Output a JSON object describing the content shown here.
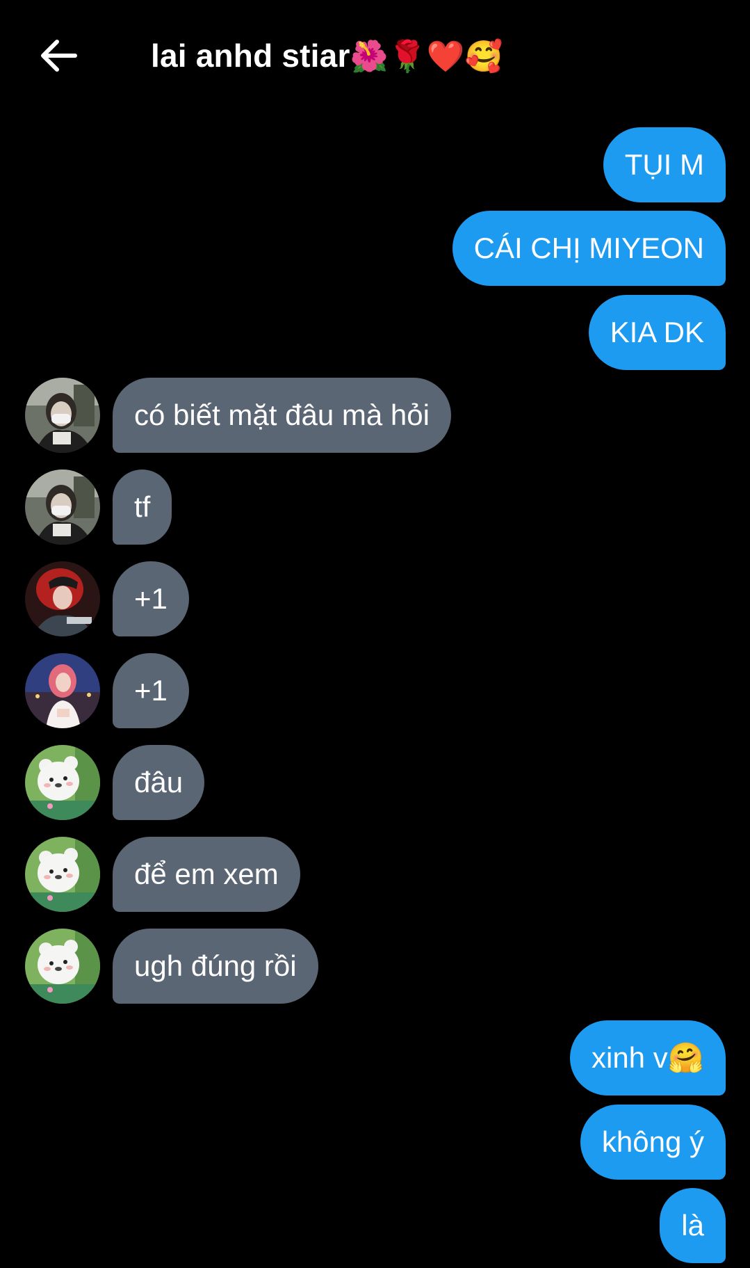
{
  "header": {
    "back_icon": "arrow-left-icon",
    "title": "lai anhd stiar",
    "title_emojis": "🌺🌹❤️🥰"
  },
  "colors": {
    "background": "#000000",
    "outgoing_bubble": "#1d9bf0",
    "incoming_bubble": "#5b6674",
    "text": "#ffffff"
  },
  "messages": [
    {
      "direction": "outgoing",
      "text": "TỤI M"
    },
    {
      "direction": "outgoing",
      "text": "CÁI CHỊ MIYEON"
    },
    {
      "direction": "outgoing",
      "text": "KIA DK"
    },
    {
      "direction": "incoming",
      "text": "có biết mặt đâu mà hỏi",
      "avatar": "masked-girl-avatar"
    },
    {
      "direction": "incoming",
      "text": "tf",
      "avatar": "masked-girl-avatar"
    },
    {
      "direction": "incoming",
      "text": "+1",
      "avatar": "red-hair-girl-avatar"
    },
    {
      "direction": "incoming",
      "text": "+1",
      "avatar": "pink-hair-girl-avatar"
    },
    {
      "direction": "incoming",
      "text": "đâu",
      "avatar": "white-bear-avatar"
    },
    {
      "direction": "incoming",
      "text": "để em xem",
      "avatar": "white-bear-avatar"
    },
    {
      "direction": "incoming",
      "text": "ugh đúng rồi",
      "avatar": "white-bear-avatar"
    },
    {
      "direction": "outgoing",
      "text": "xinh v",
      "emoji": "🤗"
    },
    {
      "direction": "outgoing",
      "text": "không ý"
    },
    {
      "direction": "outgoing",
      "text": "là"
    }
  ]
}
